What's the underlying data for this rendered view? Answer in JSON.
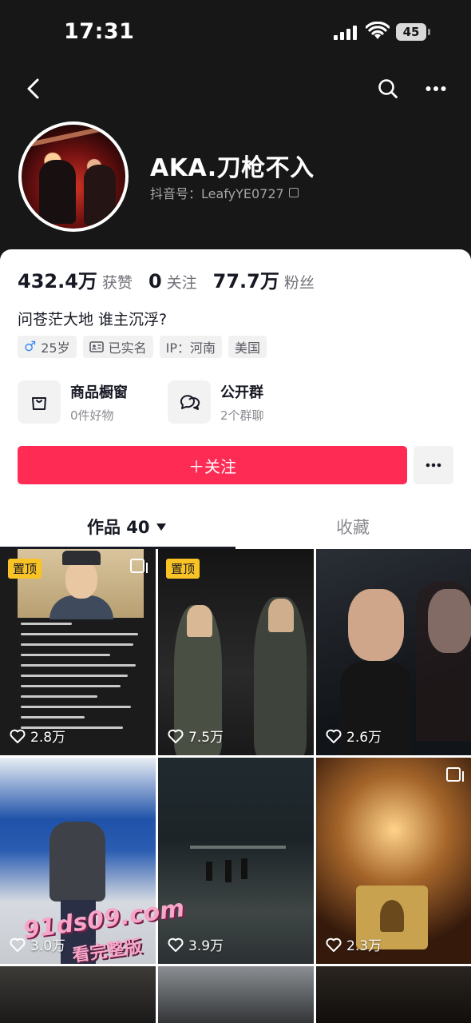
{
  "status_bar": {
    "time": "17:31",
    "battery": "45"
  },
  "profile": {
    "nickname": "AKA.刀枪不入",
    "douyin_id": "抖音号：LeafyYE0727",
    "stats": [
      {
        "value": "432.4万",
        "label": "获赞"
      },
      {
        "value": "0",
        "label": "关注"
      },
      {
        "value": "77.7万",
        "label": "粉丝"
      }
    ],
    "bio": "问苍茫大地 谁主沉浮?",
    "tags": {
      "age": "25岁",
      "verified": "已实名",
      "ip": "IP：河南",
      "country": "美国"
    }
  },
  "cards": [
    {
      "title": "商品橱窗",
      "sub": "0件好物",
      "icon": "shopping-bag-icon"
    },
    {
      "title": "公开群",
      "sub": "2个群聊",
      "icon": "chat-bubbles-icon"
    }
  ],
  "follow_button": "＋关注",
  "tabs": {
    "works": "作品 40",
    "favorites": "收藏"
  },
  "grid": [
    {
      "likes": "2.8万",
      "pinned": "置顶",
      "multi": true
    },
    {
      "likes": "7.5万",
      "pinned": "置顶",
      "multi": false
    },
    {
      "likes": "2.6万",
      "pinned": "",
      "multi": false
    },
    {
      "likes": "3.0万",
      "pinned": "",
      "multi": false
    },
    {
      "likes": "3.9万",
      "pinned": "",
      "multi": false
    },
    {
      "likes": "2.3万",
      "pinned": "",
      "multi": true
    }
  ],
  "watermark": {
    "line1": "91ds09.com",
    "line2": "看完整版"
  },
  "colors": {
    "accent": "#fe2c55",
    "pin": "#f9c225",
    "header_bg": "#171717"
  }
}
